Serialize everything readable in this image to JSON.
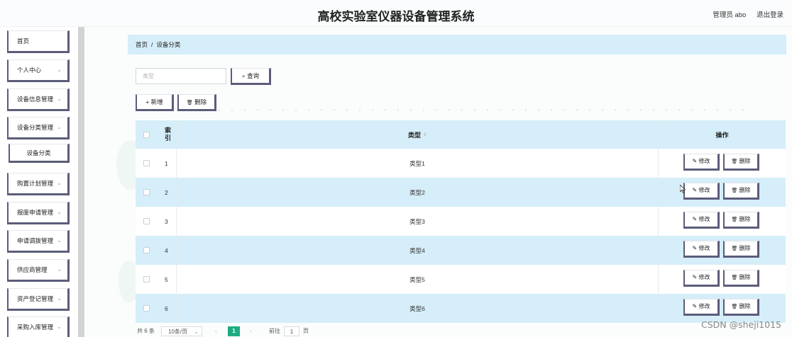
{
  "header": {
    "title": "高校实验室仪器设备管理系统",
    "user_label": "管理员 abo",
    "logout_label": "退出登录"
  },
  "sidebar": {
    "items": [
      {
        "label": "首页",
        "chevron": ""
      },
      {
        "label": "个人中心",
        "chevron": "⌄"
      },
      {
        "label": "设备信息管理",
        "chevron": "⌄"
      },
      {
        "label": "设备分类管理",
        "chevron": "⌄"
      },
      {
        "label": "设备分类",
        "chevron": ""
      },
      {
        "label": "购置计划管理",
        "chevron": "⌄"
      },
      {
        "label": "报废申请管理",
        "chevron": "⌄"
      },
      {
        "label": "申请调拨管理",
        "chevron": "⌄"
      },
      {
        "label": "供应商管理",
        "chevron": "⌄"
      },
      {
        "label": "资产登记管理",
        "chevron": "⌄"
      },
      {
        "label": "采购入库管理",
        "chevron": "⌄"
      }
    ]
  },
  "breadcrumb": {
    "home": "首页",
    "separator": "/",
    "current": "设备分类"
  },
  "search": {
    "placeholder": "类型",
    "button_label": "查询",
    "button_icon": "⌕"
  },
  "toolbar": {
    "add_label": "新增",
    "add_icon": "+",
    "delete_label": "删除",
    "delete_icon": "🗑"
  },
  "table": {
    "headers": {
      "index": "索引",
      "type": "类型",
      "type_sort_icon": "⇕",
      "ops": "操作"
    },
    "edit_label": "修改",
    "edit_icon": "✎",
    "delete_label": "删除",
    "delete_icon": "🗑",
    "rows": [
      {
        "index": "1",
        "type": "类型1"
      },
      {
        "index": "2",
        "type": "类型2"
      },
      {
        "index": "3",
        "type": "类型3"
      },
      {
        "index": "4",
        "type": "类型4"
      },
      {
        "index": "5",
        "type": "类型5"
      },
      {
        "index": "6",
        "type": "类型6"
      }
    ]
  },
  "pagination": {
    "total": "共 6 条",
    "page_size": "10条/页",
    "prev": "‹",
    "current_page": "1",
    "next": "›",
    "goto_label": "前往",
    "goto_value": "1",
    "goto_suffix": "页"
  },
  "watermark": "CSDN @sheji1015",
  "colors": {
    "accent_blue": "#d5eef9",
    "button_border": "#5c5c7a",
    "pager_active": "#1fab82"
  }
}
